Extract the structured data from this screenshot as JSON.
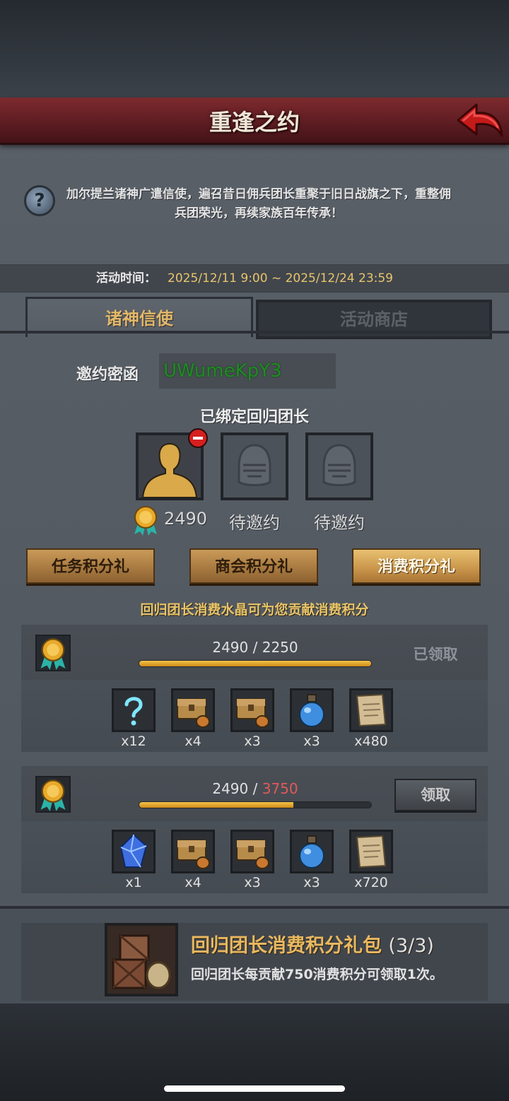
{
  "header": {
    "title": "重逢之约"
  },
  "description": "加尔提兰诸神广遣信使，遍召昔日佣兵团长重聚于旧日战旗之下，重整佣兵团荣光，再续家族百年传承！",
  "event_time": {
    "label": "活动时间：",
    "value": "2025/12/11 9:00 ~ 2025/12/24 23:59"
  },
  "tabs": [
    {
      "label": "诸神信使",
      "active": true
    },
    {
      "label": "活动商店",
      "active": false
    }
  ],
  "invite": {
    "label": "邀约密函",
    "code": "UWumeKpY3"
  },
  "bound": {
    "title": "已绑定回归团长",
    "score": "2490",
    "pending_label_1": "待邀约",
    "pending_label_2": "待邀约"
  },
  "reward_tabs": [
    "任务积分礼",
    "商会积分礼",
    "消费积分礼"
  ],
  "hint": "回归团长消费水晶可为您贡献消费积分",
  "tiers": [
    {
      "current": "2490",
      "target": "2250",
      "progress": 1.0,
      "status": "已领取",
      "items": [
        {
          "icon": "mystery-scroll-icon",
          "qty": "x12"
        },
        {
          "icon": "treasure-chest-icon",
          "qty": "x4"
        },
        {
          "icon": "treasure-chest-icon",
          "qty": "x3"
        },
        {
          "icon": "blue-potion-icon",
          "qty": "x3"
        },
        {
          "icon": "parchment-icon",
          "qty": "x480"
        }
      ]
    },
    {
      "current": "2490",
      "target": "3750",
      "progress": 0.664,
      "status": "领取",
      "items": [
        {
          "icon": "blue-crystal-icon",
          "qty": "x1"
        },
        {
          "icon": "treasure-chest-icon",
          "qty": "x4"
        },
        {
          "icon": "treasure-chest-icon",
          "qty": "x3"
        },
        {
          "icon": "blue-potion-icon",
          "qty": "x3"
        },
        {
          "icon": "parchment-icon",
          "qty": "x720"
        }
      ]
    }
  ],
  "pack": {
    "title": "回归团长消费积分礼包",
    "count": "(3/3)",
    "desc": "回归团长每贡献750消费积分可领取1次。"
  },
  "colors": {
    "accent_gold": "#e8c56a",
    "title_red": "#7e2a2e",
    "code_green": "#1f8b22",
    "target_red": "#e05a5a"
  }
}
